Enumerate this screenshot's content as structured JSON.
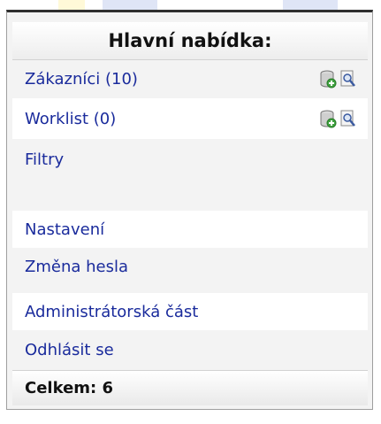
{
  "menu": {
    "title": "Hlavní nabídka:",
    "items": [
      {
        "label": "Zákazníci (10)",
        "icons": [
          "database-add-icon",
          "search-doc-icon"
        ]
      },
      {
        "label": "Worklist (0)",
        "icons": [
          "database-add-icon",
          "search-doc-icon"
        ]
      },
      {
        "label": "Filtry"
      },
      {
        "label": "Nastavení"
      },
      {
        "label": "Změna hesla"
      },
      {
        "label": "Administrátorská část"
      },
      {
        "label": "Odhlásit se"
      }
    ],
    "total": "Celkem: 6"
  },
  "colors": {
    "link": "#1a2b9c",
    "panel_bg": "#f3f3f3",
    "panel_border": "#9e9e9e"
  }
}
